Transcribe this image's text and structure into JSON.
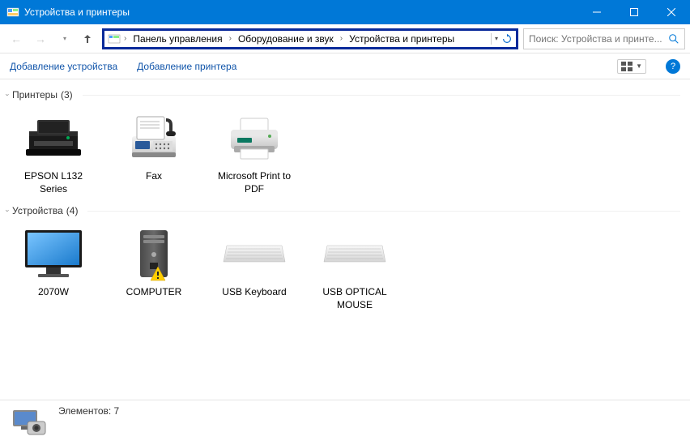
{
  "window": {
    "title": "Устройства и принтеры"
  },
  "breadcrumb": {
    "seg1": "Панель управления",
    "seg2": "Оборудование и звук",
    "seg3": "Устройства и принтеры"
  },
  "search": {
    "placeholder": "Поиск: Устройства и принте..."
  },
  "toolbar": {
    "add_device": "Добавление устройства",
    "add_printer": "Добавление принтера"
  },
  "groups": {
    "printers": {
      "label": "Принтеры",
      "count": "(3)",
      "items": [
        {
          "label": "EPSON L132 Series"
        },
        {
          "label": "Fax"
        },
        {
          "label": "Microsoft Print to PDF"
        }
      ]
    },
    "devices": {
      "label": "Устройства",
      "count": "(4)",
      "items": [
        {
          "label": "2070W"
        },
        {
          "label": "COMPUTER"
        },
        {
          "label": "USB Keyboard"
        },
        {
          "label": "USB OPTICAL MOUSE"
        }
      ]
    }
  },
  "statusbar": {
    "elements_label": "Элементов:",
    "elements_count": "7"
  }
}
